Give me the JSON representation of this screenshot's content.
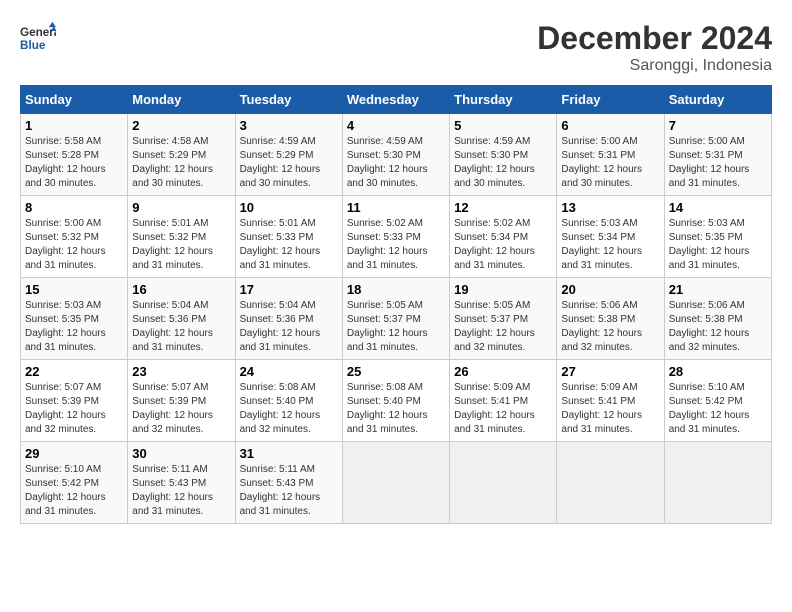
{
  "header": {
    "logo_general": "General",
    "logo_blue": "Blue",
    "month": "December 2024",
    "location": "Saronggi, Indonesia"
  },
  "weekdays": [
    "Sunday",
    "Monday",
    "Tuesday",
    "Wednesday",
    "Thursday",
    "Friday",
    "Saturday"
  ],
  "weeks": [
    [
      {
        "day": "1",
        "sunrise": "5:58 AM",
        "sunset": "5:28 PM",
        "daylight": "Daylight: 12 hours and 30 minutes."
      },
      {
        "day": "2",
        "sunrise": "4:58 AM",
        "sunset": "5:29 PM",
        "daylight": "Daylight: 12 hours and 30 minutes."
      },
      {
        "day": "3",
        "sunrise": "4:59 AM",
        "sunset": "5:29 PM",
        "daylight": "Daylight: 12 hours and 30 minutes."
      },
      {
        "day": "4",
        "sunrise": "4:59 AM",
        "sunset": "5:30 PM",
        "daylight": "Daylight: 12 hours and 30 minutes."
      },
      {
        "day": "5",
        "sunrise": "4:59 AM",
        "sunset": "5:30 PM",
        "daylight": "Daylight: 12 hours and 30 minutes."
      },
      {
        "day": "6",
        "sunrise": "5:00 AM",
        "sunset": "5:31 PM",
        "daylight": "Daylight: 12 hours and 30 minutes."
      },
      {
        "day": "7",
        "sunrise": "5:00 AM",
        "sunset": "5:31 PM",
        "daylight": "Daylight: 12 hours and 31 minutes."
      }
    ],
    [
      {
        "day": "8",
        "sunrise": "5:00 AM",
        "sunset": "5:32 PM",
        "daylight": "Daylight: 12 hours and 31 minutes."
      },
      {
        "day": "9",
        "sunrise": "5:01 AM",
        "sunset": "5:32 PM",
        "daylight": "Daylight: 12 hours and 31 minutes."
      },
      {
        "day": "10",
        "sunrise": "5:01 AM",
        "sunset": "5:33 PM",
        "daylight": "Daylight: 12 hours and 31 minutes."
      },
      {
        "day": "11",
        "sunrise": "5:02 AM",
        "sunset": "5:33 PM",
        "daylight": "Daylight: 12 hours and 31 minutes."
      },
      {
        "day": "12",
        "sunrise": "5:02 AM",
        "sunset": "5:34 PM",
        "daylight": "Daylight: 12 hours and 31 minutes."
      },
      {
        "day": "13",
        "sunrise": "5:03 AM",
        "sunset": "5:34 PM",
        "daylight": "Daylight: 12 hours and 31 minutes."
      },
      {
        "day": "14",
        "sunrise": "5:03 AM",
        "sunset": "5:35 PM",
        "daylight": "Daylight: 12 hours and 31 minutes."
      }
    ],
    [
      {
        "day": "15",
        "sunrise": "5:03 AM",
        "sunset": "5:35 PM",
        "daylight": "Daylight: 12 hours and 31 minutes."
      },
      {
        "day": "16",
        "sunrise": "5:04 AM",
        "sunset": "5:36 PM",
        "daylight": "Daylight: 12 hours and 31 minutes."
      },
      {
        "day": "17",
        "sunrise": "5:04 AM",
        "sunset": "5:36 PM",
        "daylight": "Daylight: 12 hours and 31 minutes."
      },
      {
        "day": "18",
        "sunrise": "5:05 AM",
        "sunset": "5:37 PM",
        "daylight": "Daylight: 12 hours and 31 minutes."
      },
      {
        "day": "19",
        "sunrise": "5:05 AM",
        "sunset": "5:37 PM",
        "daylight": "Daylight: 12 hours and 32 minutes."
      },
      {
        "day": "20",
        "sunrise": "5:06 AM",
        "sunset": "5:38 PM",
        "daylight": "Daylight: 12 hours and 32 minutes."
      },
      {
        "day": "21",
        "sunrise": "5:06 AM",
        "sunset": "5:38 PM",
        "daylight": "Daylight: 12 hours and 32 minutes."
      }
    ],
    [
      {
        "day": "22",
        "sunrise": "5:07 AM",
        "sunset": "5:39 PM",
        "daylight": "Daylight: 12 hours and 32 minutes."
      },
      {
        "day": "23",
        "sunrise": "5:07 AM",
        "sunset": "5:39 PM",
        "daylight": "Daylight: 12 hours and 32 minutes."
      },
      {
        "day": "24",
        "sunrise": "5:08 AM",
        "sunset": "5:40 PM",
        "daylight": "Daylight: 12 hours and 32 minutes."
      },
      {
        "day": "25",
        "sunrise": "5:08 AM",
        "sunset": "5:40 PM",
        "daylight": "Daylight: 12 hours and 31 minutes."
      },
      {
        "day": "26",
        "sunrise": "5:09 AM",
        "sunset": "5:41 PM",
        "daylight": "Daylight: 12 hours and 31 minutes."
      },
      {
        "day": "27",
        "sunrise": "5:09 AM",
        "sunset": "5:41 PM",
        "daylight": "Daylight: 12 hours and 31 minutes."
      },
      {
        "day": "28",
        "sunrise": "5:10 AM",
        "sunset": "5:42 PM",
        "daylight": "Daylight: 12 hours and 31 minutes."
      }
    ],
    [
      {
        "day": "29",
        "sunrise": "5:10 AM",
        "sunset": "5:42 PM",
        "daylight": "Daylight: 12 hours and 31 minutes."
      },
      {
        "day": "30",
        "sunrise": "5:11 AM",
        "sunset": "5:43 PM",
        "daylight": "Daylight: 12 hours and 31 minutes."
      },
      {
        "day": "31",
        "sunrise": "5:11 AM",
        "sunset": "5:43 PM",
        "daylight": "Daylight: 12 hours and 31 minutes."
      },
      null,
      null,
      null,
      null
    ]
  ]
}
